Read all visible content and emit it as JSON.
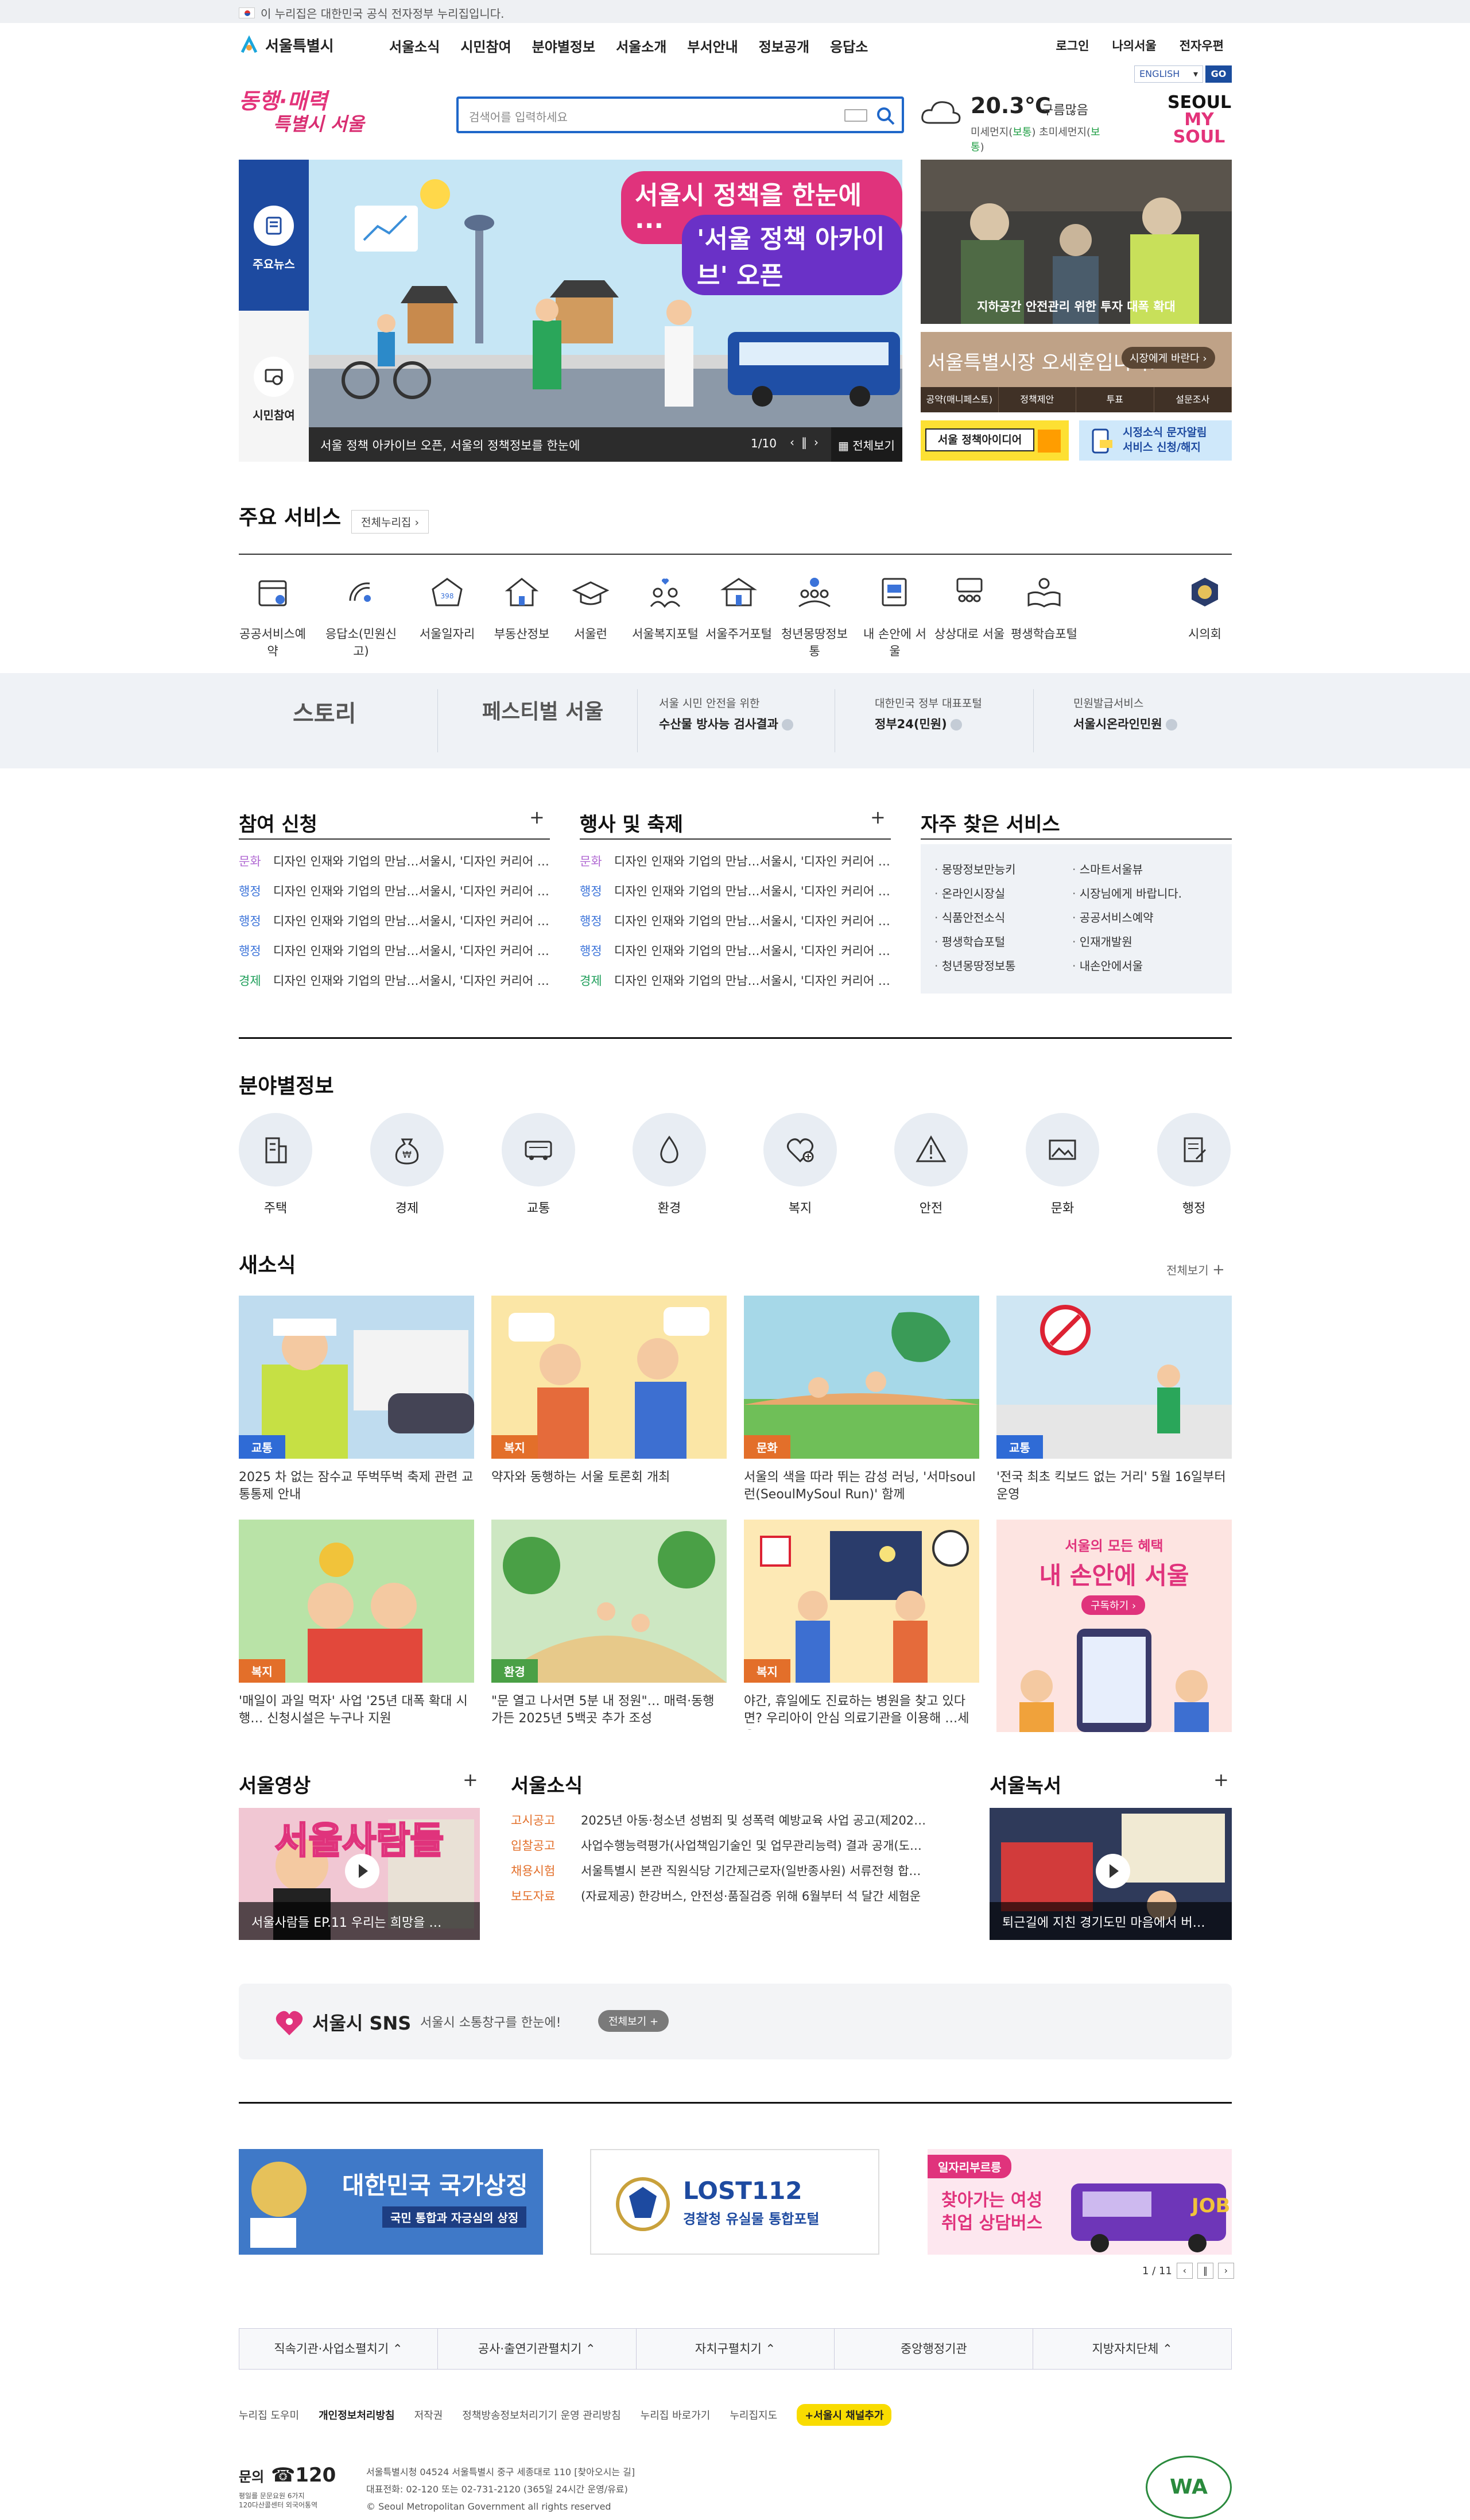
{
  "gov_strip": {
    "text": "이 누리집은 대한민국 공식 전자정부 누리집입니다."
  },
  "header": {
    "logo_text": "서울특별시",
    "gnb": [
      "서울소식",
      "시민참여",
      "분야별정보",
      "서울소개",
      "부서안내",
      "정보공개",
      "응답소"
    ],
    "util": [
      "로그인",
      "나의서울",
      "전자우편"
    ],
    "lang_select": "ENGLISH",
    "lang_go": "GO",
    "slogan_line1": "동행·매력",
    "slogan_line2": "특별시 서울",
    "search_placeholder": "검색어를 입력하세요",
    "weather": {
      "temp": "20.3℃",
      "cond": "구름많음",
      "fine_dust_label": "미세먼지",
      "fine_dust_value": "보통",
      "ultra_dust_label": "초미세먼지",
      "ultra_dust_value": "보통"
    },
    "seoul_my_soul_line1": "SEOUL",
    "seoul_my_soul_line2": "MY SOUL"
  },
  "banner": {
    "tab_news": "주요뉴스",
    "tab_participation": "시민참여",
    "headline1": "서울시 정책을 한눈에···",
    "headline2": "'서울 정책 아카이브' 오픈",
    "caption": "서울 정책 아카이브 오픈, 서울의 정책정보를 한눈에",
    "pager": "1/10",
    "view_all": "전체보기",
    "right_photo_caption": "지하공간 안전관리 위한 투자 대폭 확대",
    "mayor_text": "서울특별시장 오세훈입니다.",
    "mayor_btn": "시장에게 바란다 ›",
    "mayor_links": [
      "공약(매니페스토)",
      "정책제안",
      "투표",
      "설문조사"
    ],
    "policy_idea": "서울 정책아이디어",
    "sms_service_line1": "시정소식 문자알림",
    "sms_service_line2": "서비스 신청/해지"
  },
  "services": {
    "title": "주요 서비스",
    "all_btn": "전체누리집 ›",
    "items": [
      {
        "label": "공공서비스예약",
        "icon": "calendar-icon"
      },
      {
        "label": "응답소(민원신고)",
        "icon": "signal-icon"
      },
      {
        "label": "서울일자리",
        "icon": "jobs-icon"
      },
      {
        "label": "부동산정보",
        "icon": "house-icon"
      },
      {
        "label": "서울런",
        "icon": "graduation-icon"
      },
      {
        "label": "서울복지포털",
        "icon": "people-heart-icon"
      },
      {
        "label": "서울주거포털",
        "icon": "apartment-icon"
      },
      {
        "label": "청년몽땅정보통",
        "icon": "youth-icon"
      },
      {
        "label": "내 손안에 서울",
        "icon": "news-icon"
      },
      {
        "label": "상상대로 서울",
        "icon": "meeting-icon"
      },
      {
        "label": "평생학습포털",
        "icon": "book-icon"
      },
      {
        "label": "시의회",
        "icon": "council-icon"
      }
    ]
  },
  "band": {
    "story": "스토리",
    "festival": "페스티벌 서울",
    "items": [
      {
        "small": "서울 시민 안전을 위한",
        "big": "수산물 방사능 검사결과"
      },
      {
        "small": "대한민국 정부 대표포털",
        "big": "정부24(민원)"
      },
      {
        "small": "민원발급서비스",
        "big": "서울시온라인민원"
      }
    ]
  },
  "boards": {
    "participation": {
      "title": "참여 신청",
      "items": [
        {
          "cat": "문화",
          "text": "디자인 인재와 기업의 만남…서울시, '디자인 커리어 …"
        },
        {
          "cat": "행정",
          "text": "디자인 인재와 기업의 만남…서울시, '디자인 커리어 …"
        },
        {
          "cat": "행정",
          "text": "디자인 인재와 기업의 만남…서울시, '디자인 커리어 …"
        },
        {
          "cat": "행정",
          "text": "디자인 인재와 기업의 만남…서울시, '디자인 커리어 …"
        },
        {
          "cat": "경제",
          "text": "디자인 인재와 기업의 만남…서울시, '디자인 커리어 …"
        }
      ]
    },
    "events": {
      "title": "행사 및 축제",
      "items": [
        {
          "cat": "문화",
          "text": "디자인 인재와 기업의 만남…서울시, '디자인 커리어 …"
        },
        {
          "cat": "행정",
          "text": "디자인 인재와 기업의 만남…서울시, '디자인 커리어 …"
        },
        {
          "cat": "행정",
          "text": "디자인 인재와 기업의 만남…서울시, '디자인 커리어 …"
        },
        {
          "cat": "행정",
          "text": "디자인 인재와 기업의 만남…서울시, '디자인 커리어 …"
        },
        {
          "cat": "경제",
          "text": "디자인 인재와 기업의 만남…서울시, '디자인 커리어 …"
        }
      ]
    },
    "favorites": {
      "title": "자주 찾은 서비스",
      "left": [
        "몽땅정보만능키",
        "온라인시장실",
        "식품안전소식",
        "평생학습포털",
        "청년몽땅정보통"
      ],
      "right": [
        "스마트서울뷰",
        "시장님에게 바랍니다.",
        "공공서비스예약",
        "인재개발원",
        "내손안에서울"
      ]
    }
  },
  "fields": {
    "title": "분야별정보",
    "items": [
      {
        "label": "주택",
        "icon": "building-icon"
      },
      {
        "label": "경제",
        "icon": "money-bag-icon"
      },
      {
        "label": "교통",
        "icon": "bus-icon"
      },
      {
        "label": "환경",
        "icon": "water-drop-icon"
      },
      {
        "label": "복지",
        "icon": "heart-plus-icon"
      },
      {
        "label": "안전",
        "icon": "warning-icon"
      },
      {
        "label": "문화",
        "icon": "picture-icon"
      },
      {
        "label": "행정",
        "icon": "document-icon"
      }
    ]
  },
  "news": {
    "title": "새소식",
    "view_all": "전체보기",
    "items": [
      {
        "badge": "교통",
        "color": "#2f6bd6",
        "bg": "#bfdcef",
        "caption": "2025 차 없는 잠수교 뚜벅뚜벅 축제 관련 교통통제 안내"
      },
      {
        "badge": "복지",
        "color": "#e36f2a",
        "bg": "#fbe6a6",
        "caption": "약자와 동행하는 서울 토론회 개최"
      },
      {
        "badge": "문화",
        "color": "#e36f2a",
        "bg": "#a6d8e8",
        "caption": "서울의 색을 따라 뛰는 감성 러닝, '서마soul런(SeoulMySoul Run)' 함께"
      },
      {
        "badge": "교통",
        "color": "#2f6bd6",
        "bg": "#cfe6f3",
        "caption": "'전국 최초 킥보드 없는 거리' 5월 16일부터 운영"
      },
      {
        "badge": "복지",
        "color": "#e36f2a",
        "bg": "#b9e3a7",
        "caption": "'매일이 과일 먹자' 사업 '25년 대폭 확대 시행… 신청시설은 누구나 지원"
      },
      {
        "badge": "환경",
        "color": "#4aa046",
        "bg": "#cde7c2",
        "caption": "\"문 열고 나서면 5분 내 정원\"… 매력·동행 가든 2025년 5백곳 추가 조성"
      },
      {
        "badge": "복지",
        "color": "#e36f2a",
        "bg": "#fde9b5",
        "caption": "야간, 휴일에도 진료하는 병원을 찾고 있다면? 우리아이 안심 의료기관을 이용해 …세요"
      },
      {
        "badge": "",
        "color": "#e36f2a",
        "bg": "#fde4e1",
        "caption": "",
        "promo1": "서울의 모든 혜택",
        "promo2": "내 손안에 서울",
        "promo3": "구독하기 ›"
      }
    ]
  },
  "media": {
    "video_title": "서울영상",
    "video_caption": "서울사람들 EP.11 우리는 희망을 …",
    "video_overlay": "서울사람들",
    "notice_title": "서울소식",
    "notices": [
      {
        "cat": "고시공고",
        "text": "2025년 아동·청소년 성범죄 및 성폭력 예방교육 사업 공고(제202…"
      },
      {
        "cat": "입찰공고",
        "text": "사업수행능력평가(사업책임기술인 및 업무관리능력) 결과 공개(도…"
      },
      {
        "cat": "채용시험",
        "text": "서울특별시 본관 직원식당 기간제근로자(일반종사원) 서류전형 합…"
      },
      {
        "cat": "보도자료",
        "text": "(자료제공) 한강버스, 안전성·품질검증 위해 6월부터 석 달간 세험운"
      }
    ],
    "audio_title": "서울녹서",
    "audio_caption": "퇴근길에 지친 경기도민 마음에서 버…"
  },
  "sns": {
    "title": "서울시 SNS",
    "sub": "서울시 소통창구를 한눈에!",
    "btn": "전체보기 +"
  },
  "promos": {
    "p1_title": "대한민국 국가상징",
    "p1_sub": "국민 통합과 자긍심의 상징",
    "p2_title": "LOST112",
    "p2_sub": "경찰청 유실물 통합포털",
    "p3_tag": "일자리부르릉",
    "p3_line1": "찾아가는 여성",
    "p3_line2": "취업 상담버스",
    "pager": "1 / 11"
  },
  "sites_bar": [
    "직속기관·사업소펼치기 ⌃",
    "공사·출연기관펼치기 ⌃",
    "자치구펼치기 ⌃",
    "중앙행정기관",
    "지방자치단체 ⌃"
  ],
  "footer": {
    "links": [
      "누리집 도우미",
      "개인정보처리방침",
      "저작권",
      "정책방송정보처리기기 운영 관리방침",
      "누리집 바로가기",
      "누리집지도"
    ],
    "kakao": "+서울시 채널추가",
    "call_label": "문의",
    "call_number": "☎120",
    "call_sub1": "평일를 문문요원 6가지",
    "call_sub2": "120다산콜센터 외국어통역",
    "addr1": "서울특별시청 04524 서울특별시 중구 세종대로 110 [찾아오시는 길]",
    "addr2": "대표전화: 02-120 또는 02-731-2120 (365일 24시간 운영/유료)",
    "addr3": "© Seoul Metropolitan Government all rights reserved",
    "wa": "WA"
  }
}
